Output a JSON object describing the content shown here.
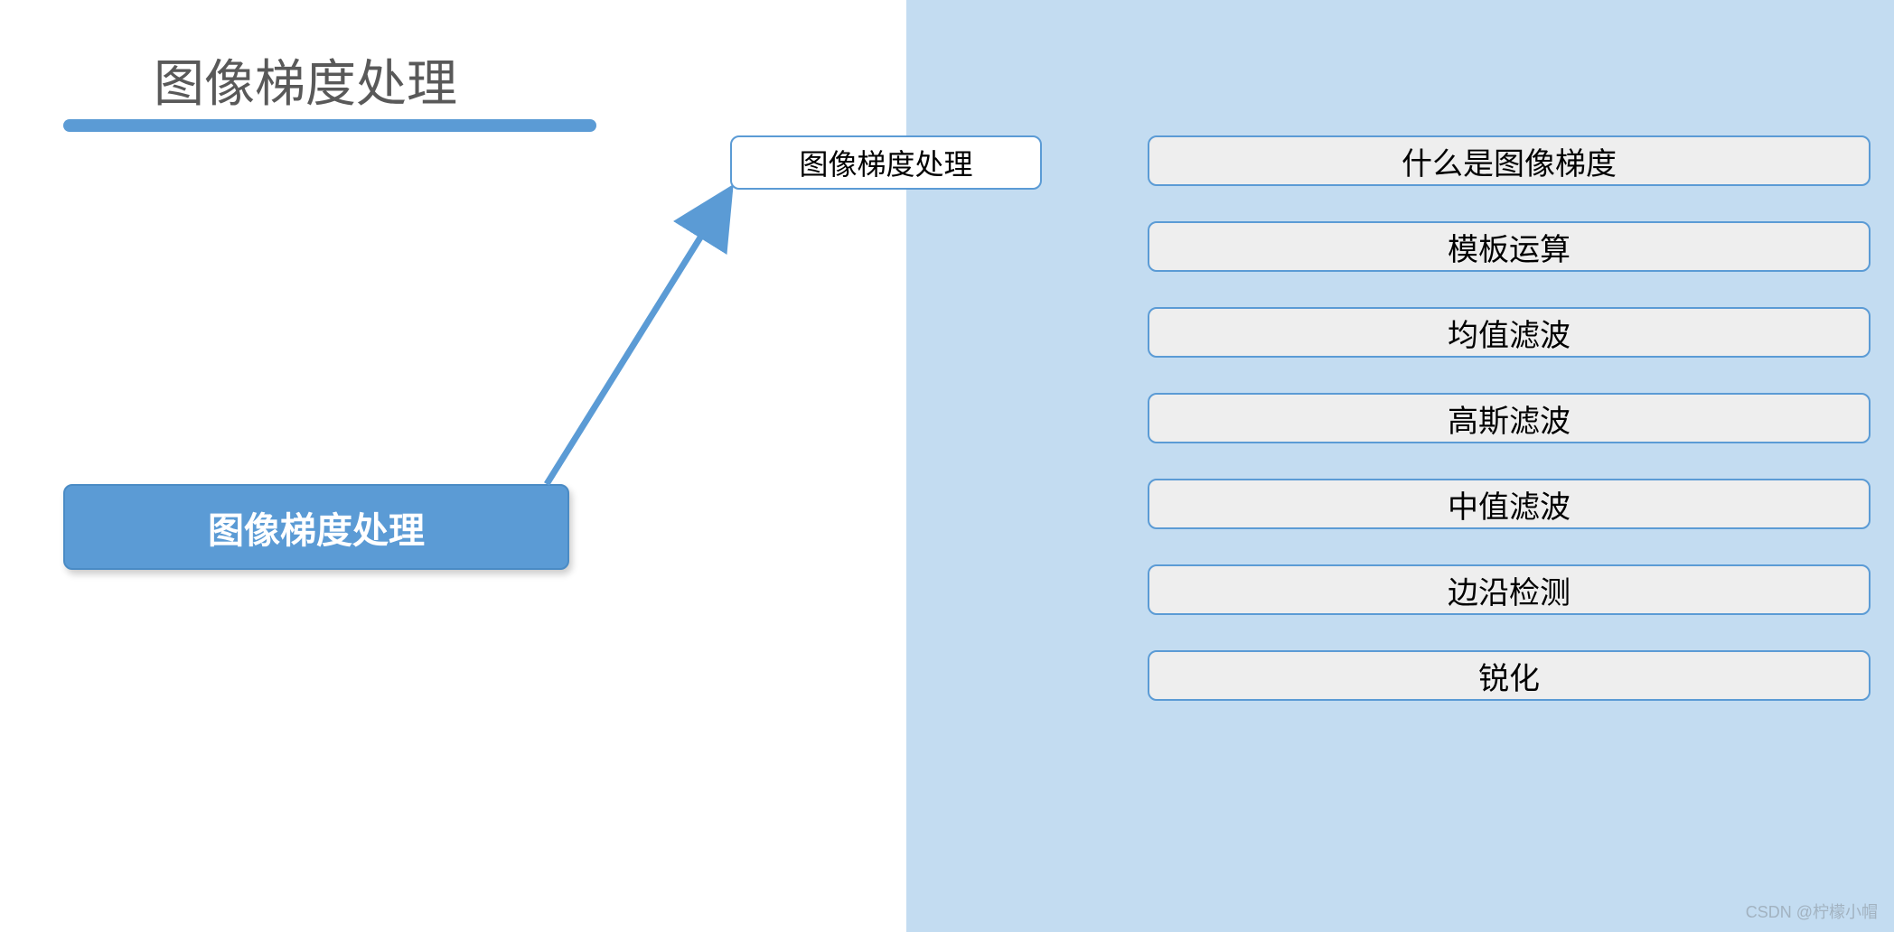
{
  "title": "图像梯度处理",
  "source_node": "图像梯度处理",
  "target_node": "图像梯度处理",
  "items": [
    "什么是图像梯度",
    "模板运算",
    "均值滤波",
    "高斯滤波",
    "中值滤波",
    "边沿检测",
    "锐化"
  ],
  "watermark": "CSDN @柠檬小帽",
  "colors": {
    "accent": "#5b9bd5",
    "panel_bg": "#c3dcf1",
    "item_bg": "#eeeeee",
    "title_color": "#595959"
  }
}
